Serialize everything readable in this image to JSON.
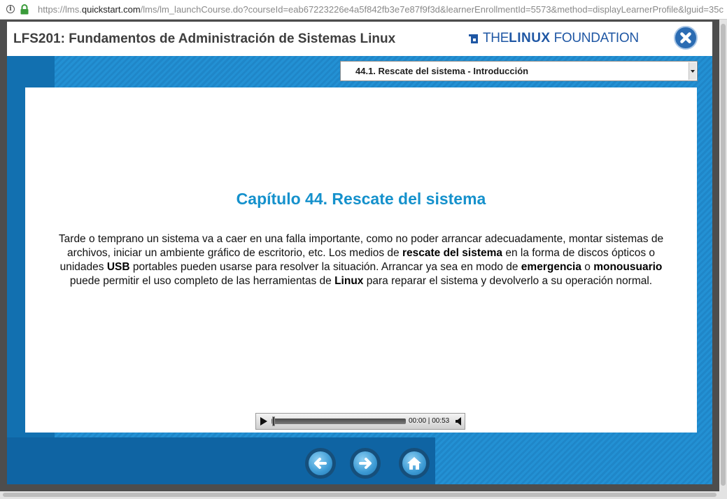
{
  "browser": {
    "url_prefix": "https://lms.",
    "url_host": "quickstart.com",
    "url_rest": "/lms/lm_launchCourse.do?courseId=eab67223226e4a5f842fb3e7e87f9f3d&learnerEnrollmentId=5573&method=displayLearnerProfile&lguid=35c"
  },
  "header": {
    "course_title": "LFS201: Fundamentos de Administración de Sistemas Linux",
    "logo_the": "THE",
    "logo_linux": "LINUX",
    "logo_foundation": "FOUNDATION"
  },
  "chapter_select": {
    "selected": "44.1. Rescate del sistema - Introducción"
  },
  "content": {
    "heading": "Capítulo 44. Rescate del sistema",
    "p1": "Tarde o temprano un sistema va a caer en una falla importante, como no poder arrancar adecuadamente, montar sistemas de archivos, iniciar un ambiente gráfico de escritorio, etc. Los medios de ",
    "b1": "rescate del sistema",
    "p2": " en la forma de discos ópticos o unidades ",
    "b2": "USB",
    "p3": " portables pueden usarse para resolver la situación. Arrancar ya sea en modo de ",
    "b3": "emergencia",
    "p4": " o ",
    "b4": "monousuario",
    "p5": " puede permitir el uso completo de las herramientas de ",
    "b5": "Linux",
    "p6": " para reparar el sistema y devolverlo a su operación normal."
  },
  "audio": {
    "current": "00:00",
    "separator": " | ",
    "duration": "00:53",
    "progress": 0
  },
  "colors": {
    "accent": "#1591cc",
    "stage_blue": "#1a7fbf",
    "logo_blue": "#1f57a4"
  },
  "icons": {
    "info": "info-icon",
    "lock": "lock-icon",
    "close": "close-icon",
    "play": "play-icon",
    "volume": "volume-icon",
    "back": "arrow-left-icon",
    "next": "arrow-right-icon",
    "home": "home-icon"
  }
}
